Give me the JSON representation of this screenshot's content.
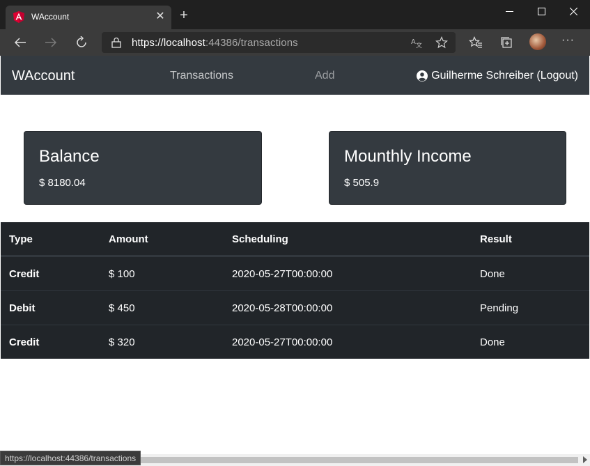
{
  "browser": {
    "tab_title": "WAccount",
    "tab_close": "✕",
    "new_tab": "+",
    "url_host": "https://localhost",
    "url_rest": ":44386/transactions",
    "more": "···",
    "status_url": "https://localhost:44386/transactions",
    "icons": [
      "angular-icon",
      "back-icon",
      "forward-icon",
      "refresh-icon",
      "lock-icon",
      "translate-icon",
      "star-icon",
      "favorites-icon",
      "collections-icon"
    ]
  },
  "navbar": {
    "brand": "WAccount",
    "links": [
      "Transactions",
      "Add"
    ],
    "user": "Guilherme Schreiber (Logout)"
  },
  "cards": {
    "balance": {
      "title": "Balance",
      "value": "$ 8180.04"
    },
    "income": {
      "title": "Mounthly Income",
      "value": "$ 505.9"
    }
  },
  "table": {
    "headers": [
      "Type",
      "Amount",
      "Scheduling",
      "Result"
    ],
    "rows": [
      {
        "type": "Credit",
        "amount": "$ 100",
        "scheduling": "2020-05-27T00:00:00",
        "result": "Done"
      },
      {
        "type": "Debit",
        "amount": "$ 450",
        "scheduling": "2020-05-28T00:00:00",
        "result": "Pending"
      },
      {
        "type": "Credit",
        "amount": "$ 320",
        "scheduling": "2020-05-27T00:00:00",
        "result": "Done"
      }
    ]
  },
  "colors": {
    "navbar_bg": "#343a40",
    "table_bg": "#212529",
    "card_bg": "#343a40",
    "angular_red": "#dd0031"
  }
}
